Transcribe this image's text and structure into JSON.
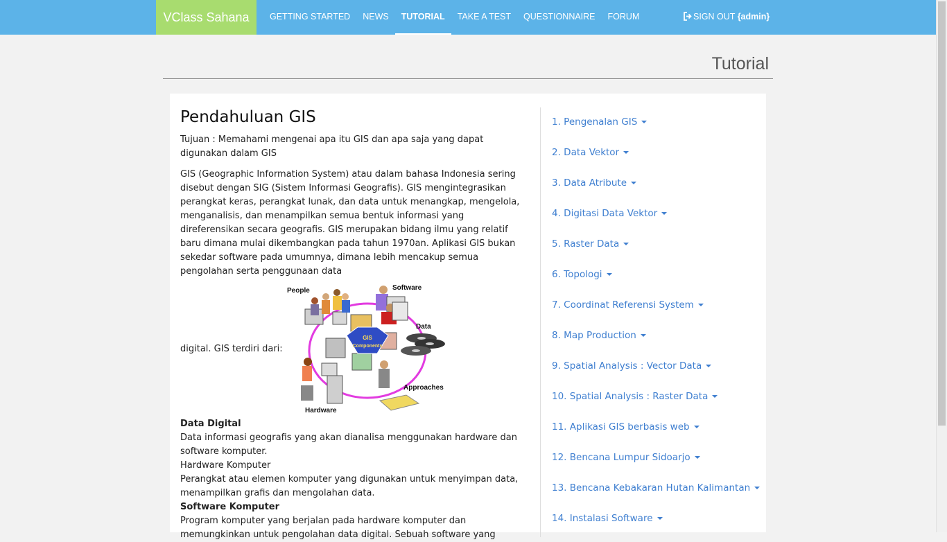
{
  "brand": "VClass Sahana",
  "nav": {
    "items": [
      "GETTING STARTED",
      "NEWS",
      "TUTORIAL",
      "TAKE A TEST",
      "QUESTIONNAIRE",
      "FORUM"
    ],
    "active": "TUTORIAL",
    "signout_label": "SIGN OUT",
    "user": "{admin}"
  },
  "page": {
    "title": "Tutorial"
  },
  "article": {
    "heading": "Pendahuluan GIS",
    "goal": "Tujuan : Memahami mengenai apa itu GIS dan apa saja yang dapat digunakan dalam GIS",
    "intro": "GIS (Geographic Information System) atau dalam bahasa Indonesia sering disebut dengan SIG (Sistem Informasi Geografis). GIS mengintegrasikan perangkat keras, perangkat lunak, dan data untuk menangkap, mengelola, menganalisis, dan menampilkan semua bentuk informasi yang direferensikan secara geografis. GIS merupakan bidang ilmu yang relatif baru dimana mulai dikembangkan pada tahun 1970an. Aplikasi GIS bukan sekedar software pada umumnya, dimana lebih mencakup semua pengolahan serta penggunaan data",
    "figure_caption": "digital. GIS terdiri dari:",
    "figure_labels": {
      "people": "People",
      "software": "Software",
      "data": "Data",
      "approaches": "Approaches",
      "hardware": "Hardware",
      "center_line1": "GIS",
      "center_line2": "Components"
    },
    "data_digital_title": "Data Digital",
    "data_digital_text": "Data informasi geografis yang akan dianalisa menggunakan hardware dan software komputer.",
    "hardware_title": "Hardware Komputer",
    "hardware_text": "Perangkat atau elemen komputer yang digunakan untuk menyimpan data, menampilkan grafis dan mengolahan data.",
    "software_title": "Software Komputer",
    "software_text": "Program komputer yang berjalan pada hardware komputer dan memungkinkan untuk pengolahan data digital. Sebuah software yang"
  },
  "toc": [
    "1. Pengenalan GIS",
    "2. Data Vektor",
    "3. Data Atribute",
    "4. Digitasi Data Vektor",
    "5. Raster Data",
    "6. Topologi",
    "7. Coordinat Referensi System",
    "8. Map Production",
    "9. Spatial Analysis : Vector Data",
    "10. Spatial Analysis : Raster Data",
    "11. Aplikasi GIS berbasis web",
    "12. Bencana Lumpur Sidoarjo",
    "13. Bencana Kebakaran Hutan Kalimantan",
    "14. Instalasi Software"
  ],
  "colors": {
    "navbar": "#5cb3e8",
    "brand": "#a8dc6f",
    "link": "#3f7fd0",
    "ring": "#e23be0",
    "center": "#2f4cc4"
  }
}
